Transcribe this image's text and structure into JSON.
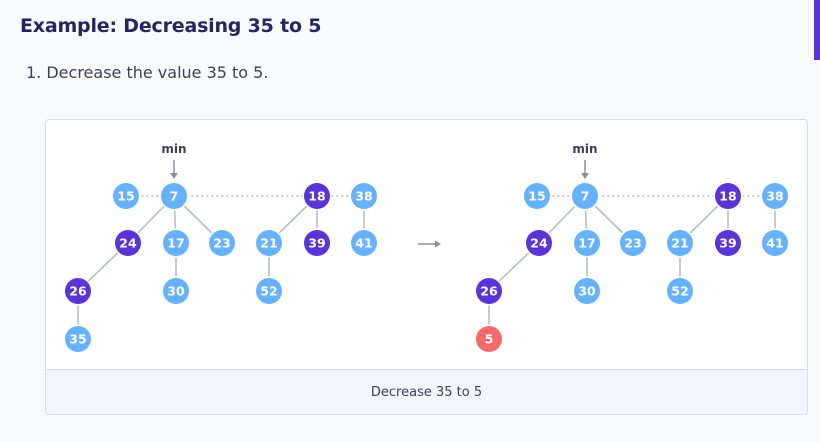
{
  "heading": "Example: Decreasing 35 to 5",
  "steps": [
    "1. Decrease the value 35 to 5."
  ],
  "figure": {
    "caption": "Decrease 35 to 5",
    "min_label": "min",
    "colors": {
      "light_node": "#66b2ff",
      "dark_node": "#5b33d6",
      "highlight_node": "#f66a6a",
      "edge": "#b8bcc6",
      "root_link": "#b8bcc6"
    },
    "panels": [
      {
        "nodes": [
          {
            "id": "n15",
            "label": "15",
            "color": "light"
          },
          {
            "id": "n7",
            "label": "7",
            "color": "light"
          },
          {
            "id": "n18",
            "label": "18",
            "color": "dark"
          },
          {
            "id": "n38",
            "label": "38",
            "color": "light"
          },
          {
            "id": "n24",
            "label": "24",
            "color": "dark"
          },
          {
            "id": "n17",
            "label": "17",
            "color": "light"
          },
          {
            "id": "n23",
            "label": "23",
            "color": "light"
          },
          {
            "id": "n21",
            "label": "21",
            "color": "light"
          },
          {
            "id": "n39",
            "label": "39",
            "color": "dark"
          },
          {
            "id": "n41",
            "label": "41",
            "color": "light"
          },
          {
            "id": "n26",
            "label": "26",
            "color": "dark"
          },
          {
            "id": "n30",
            "label": "30",
            "color": "light"
          },
          {
            "id": "n52",
            "label": "52",
            "color": "light"
          },
          {
            "id": "n35",
            "label": "35",
            "color": "light"
          }
        ],
        "edges": [
          [
            "n7",
            "n24"
          ],
          [
            "n7",
            "n17"
          ],
          [
            "n7",
            "n23"
          ],
          [
            "n18",
            "n21"
          ],
          [
            "n18",
            "n39"
          ],
          [
            "n38",
            "n41"
          ],
          [
            "n24",
            "n26"
          ],
          [
            "n17",
            "n30"
          ],
          [
            "n21",
            "n52"
          ],
          [
            "n26",
            "n35"
          ]
        ],
        "root_list": [
          "n15",
          "n7",
          "n18",
          "n38"
        ],
        "min_node": "n7"
      },
      {
        "nodes": [
          {
            "id": "m15",
            "label": "15",
            "color": "light"
          },
          {
            "id": "m7",
            "label": "7",
            "color": "light"
          },
          {
            "id": "m18",
            "label": "18",
            "color": "dark"
          },
          {
            "id": "m38",
            "label": "38",
            "color": "light"
          },
          {
            "id": "m24",
            "label": "24",
            "color": "dark"
          },
          {
            "id": "m17",
            "label": "17",
            "color": "light"
          },
          {
            "id": "m23",
            "label": "23",
            "color": "light"
          },
          {
            "id": "m21",
            "label": "21",
            "color": "light"
          },
          {
            "id": "m39",
            "label": "39",
            "color": "dark"
          },
          {
            "id": "m41",
            "label": "41",
            "color": "light"
          },
          {
            "id": "m26",
            "label": "26",
            "color": "dark"
          },
          {
            "id": "m30",
            "label": "30",
            "color": "light"
          },
          {
            "id": "m52",
            "label": "52",
            "color": "light"
          },
          {
            "id": "m5",
            "label": "5",
            "color": "highlight"
          }
        ],
        "edges": [
          [
            "m7",
            "m24"
          ],
          [
            "m7",
            "m17"
          ],
          [
            "m7",
            "m23"
          ],
          [
            "m18",
            "m21"
          ],
          [
            "m18",
            "m39"
          ],
          [
            "m38",
            "m41"
          ],
          [
            "m24",
            "m26"
          ],
          [
            "m17",
            "m30"
          ],
          [
            "m21",
            "m52"
          ],
          [
            "m26",
            "m5"
          ]
        ],
        "root_list": [
          "m15",
          "m7",
          "m18",
          "m38"
        ],
        "min_node": "m7"
      }
    ]
  }
}
